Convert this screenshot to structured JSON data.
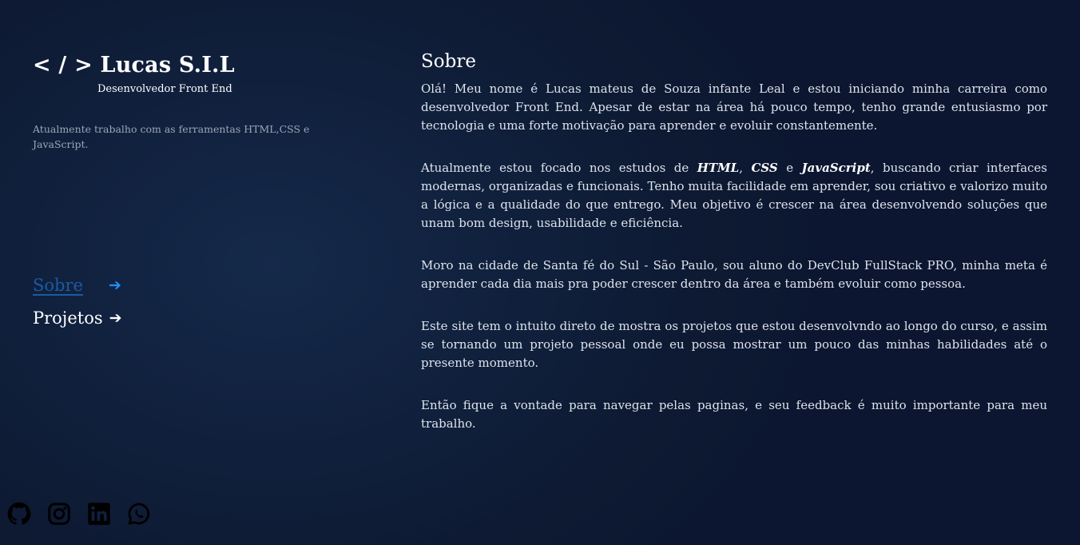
{
  "header": {
    "brand_symbol": "< / >",
    "brand_name": "Lucas S.I.L",
    "subtitle": "Desenvolvedor Front End"
  },
  "intro": "Atualmente trabalho com as ferramentas HTML,CSS e JavaScript.",
  "nav": {
    "items": [
      {
        "label": "Sobre",
        "arrow": "➔",
        "active": true
      },
      {
        "label": "Projetos",
        "arrow": "➔",
        "active": false
      }
    ]
  },
  "socials": [
    {
      "icon": "github-icon"
    },
    {
      "icon": "instagram-icon"
    },
    {
      "icon": "linkedin-icon"
    },
    {
      "icon": "whatsapp-icon"
    }
  ],
  "about": {
    "title": "Sobre",
    "p1": "Olá! Meu nome é Lucas mateus de Souza infante Leal e estou iniciando minha carreira como desenvolvedor Front End. Apesar de estar na área há pouco tempo, tenho grande entusiasmo por tecnologia e uma forte motivação para aprender e evoluir constantemente.",
    "p2": {
      "before": "Atualmente estou focado nos estudos de ",
      "html": "HTML",
      "sep1": ", ",
      "css": "CSS",
      "sep2": " e ",
      "js": "JavaScript",
      "after": ", buscando criar interfaces modernas, organizadas e funcionais. Tenho muita facilidade em aprender, sou criativo e valorizo muito a lógica e a qualidade do que entrego. Meu objetivo é crescer na área desenvolvendo soluções que unam bom design, usabilidade e eficiência."
    },
    "p3": "Moro na cidade de Santa fé do Sul - São Paulo, sou aluno do DevClub FullStack PRO, minha meta é aprender cada dia mais pra poder crescer dentro da área e também evoluir como pessoa.",
    "p4": "Este site tem o intuito direto de mostra os projetos que estou desenvolvndo ao longo do curso, e assim se tornando um projeto pessoal onde eu possa mostrar um pouco das minhas habilidades até o presente momento.",
    "p5": "Então fique a vontade para navegar pelas paginas, e seu feedback é muito importante para meu trabalho."
  },
  "colors": {
    "background": "#10203c",
    "active_link": "#1c5aa3",
    "active_arrow": "#1e90ff",
    "text": "#dde3ec",
    "muted": "#9aa6b8"
  }
}
